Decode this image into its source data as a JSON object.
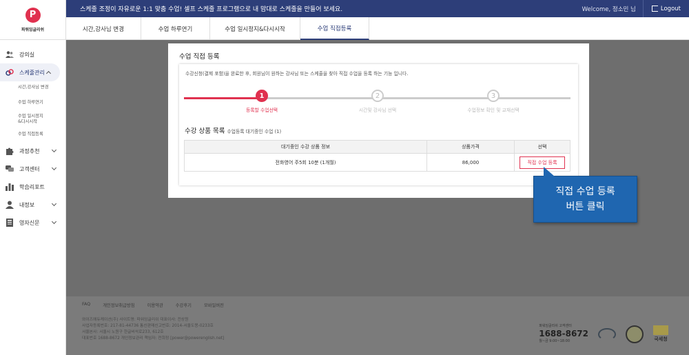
{
  "brand": {
    "logo_letter": "P",
    "name": "파워잉글리쉬"
  },
  "topbar": {
    "notice": "스케줄 조정이 자유로운 1:1 맞춤 수업! 셀프 스케줄 프로그램으로 내 맘대로 스케줄을 만들어 보세요.",
    "welcome": "Welcome, 정소민 님",
    "logout": "Logout"
  },
  "tabs": [
    "시간,강사님 변경",
    "수업 하루연기",
    "수업 일시정지&다시시작",
    "수업 직접등록"
  ],
  "sidebar": {
    "menus": [
      {
        "label": "강의실",
        "icon": "users-icon"
      },
      {
        "label": "스케줄관리",
        "icon": "link-icon"
      },
      {
        "label": "과정추천",
        "icon": "puzzle-icon"
      },
      {
        "label": "고객센터",
        "icon": "chat-icon"
      },
      {
        "label": "학습리포트",
        "icon": "bar-chart-icon"
      },
      {
        "label": "내정보",
        "icon": "user-icon"
      },
      {
        "label": "영자신문",
        "icon": "newspaper-icon"
      }
    ],
    "submenu": [
      "시간,강사님 변경",
      "수업 하루연기",
      "수업 일시정지",
      "&다시시작",
      "수업 직접등록"
    ]
  },
  "modal": {
    "title": "수업 직접 등록",
    "desc": "수강신청(결제 포함)을 완료한 후, 회원님이 원하는 강사님 또는 스케줄을 찾아 직접 수업을 등록 하는 기능 입니다.",
    "steps": [
      {
        "num": "1",
        "label": "등록할 수업선택",
        "active": true
      },
      {
        "num": "2",
        "label": "시간및 강사님 선택",
        "active": false
      },
      {
        "num": "3",
        "label": "수업정보 확인 및 교재선택",
        "active": false
      }
    ],
    "section_title": "수강 상품 목록",
    "section_sub": "수업등록 대기중인 수업 (1)",
    "table": {
      "headers": [
        "대기중인 수강 상품 정보",
        "상품가격",
        "선택"
      ],
      "rows": [
        {
          "product": "전화영어 주5회 10분 (1개월)",
          "price": "86,000",
          "action": "직접 수업 등록"
        }
      ]
    }
  },
  "callout": {
    "line1": "직접 수업 등록",
    "line2": "버튼 클릭"
  },
  "footer": {
    "links": [
      "FAQ",
      "개인정보취급방침",
      "이용약관",
      "수강후기",
      "모바일버전"
    ],
    "info": [
      "와이즈에듀케이션(주) 사이트명: 파워잉글리쉬 대표이사: 전상원",
      "사업자등록번호: 217-81-44736 통신판매신고번호: 2014-서울도봉-0233호",
      "서울본사: 서울시 노원구 한글비석로233, 612호",
      "대표번호 1688-8672 개인정보관리 책임자: 전희정 [power@powerenglish.net]"
    ],
    "phone_label": "파워잉글리쉬 고객센터",
    "phone": "1688-8672",
    "hours": "월~금 9:00~18:00",
    "ntax": "국세청"
  },
  "colors": {
    "primary": "#2d3e79",
    "accent": "#e0314f",
    "callout": "#1f66b0"
  }
}
